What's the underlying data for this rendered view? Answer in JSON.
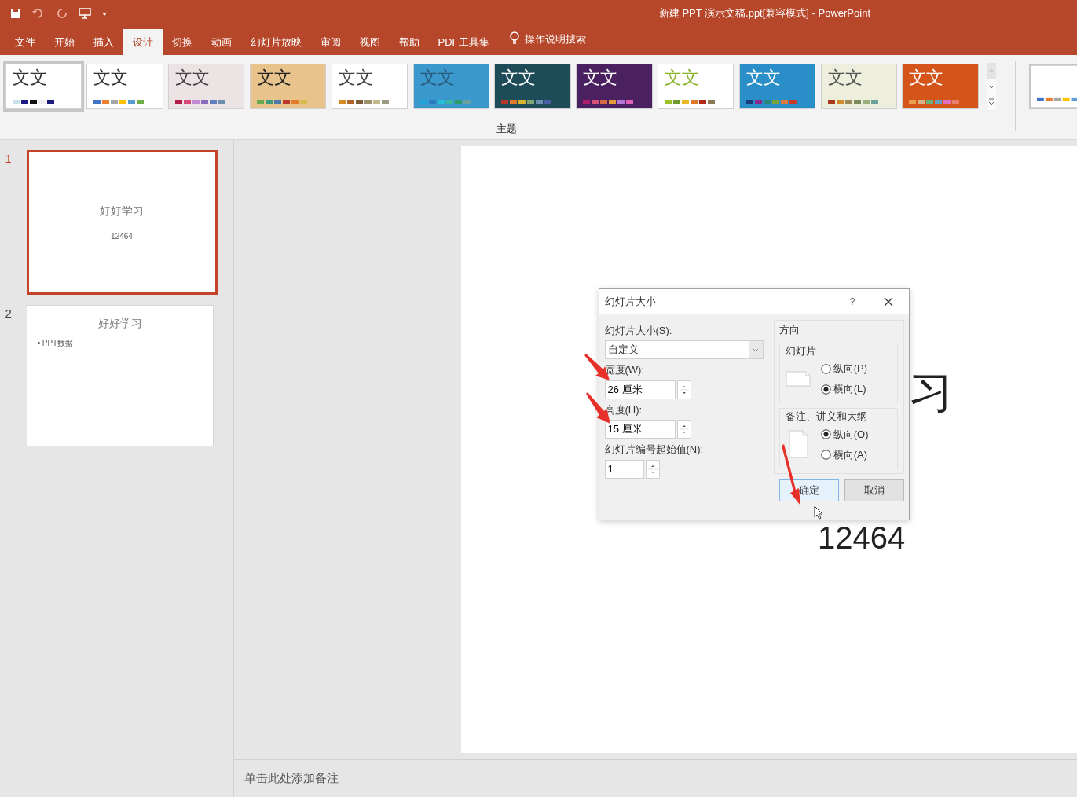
{
  "window": {
    "title": "新建 PPT 演示文稿.ppt[兼容模式]  -  PowerPoint"
  },
  "tabs": [
    {
      "label": "文件",
      "selected": false
    },
    {
      "label": "开始",
      "selected": false
    },
    {
      "label": "插入",
      "selected": false
    },
    {
      "label": "设计",
      "selected": true
    },
    {
      "label": "切换",
      "selected": false
    },
    {
      "label": "动画",
      "selected": false
    },
    {
      "label": "幻灯片放映",
      "selected": false
    },
    {
      "label": "审阅",
      "selected": false
    },
    {
      "label": "视图",
      "selected": false
    },
    {
      "label": "帮助",
      "selected": false
    },
    {
      "label": "PDF工具集",
      "selected": false
    }
  ],
  "tell_me": {
    "placeholder": "操作说明搜索"
  },
  "themes": [
    {
      "sample": {
        "text": "文文",
        "color": "#333333"
      },
      "selected": true,
      "color": "#ffffff",
      "swatches": [
        {
          "color": "#c9e2ea"
        },
        {
          "color": "#1a1a80"
        },
        {
          "color": "#111111"
        },
        {
          "color": "#eeeeee"
        },
        {
          "color": "#1a1a80"
        }
      ]
    },
    {
      "sample": {
        "text": "文文",
        "color": "#333333"
      },
      "selected": false,
      "color": "#ffffff",
      "swatches": [
        {
          "color": "#4472c4"
        },
        {
          "color": "#ed7d31"
        },
        {
          "color": "#a5a5a5"
        },
        {
          "color": "#ffc000"
        },
        {
          "color": "#5b9bd5"
        },
        {
          "color": "#70ad47"
        }
      ]
    },
    {
      "sample": {
        "text": "文文",
        "color": "#444444"
      },
      "selected": false,
      "color": "#ece4e4",
      "swatches": [
        {
          "color": "#b31b4b"
        },
        {
          "color": "#d6477a"
        },
        {
          "color": "#c28ad1"
        },
        {
          "color": "#8a6bbe"
        },
        {
          "color": "#5f7dbf"
        },
        {
          "color": "#6c8fae"
        }
      ]
    },
    {
      "sample": {
        "text": "文文",
        "color": "#222222"
      },
      "selected": false,
      "color": "#e8c48c",
      "swatches": [
        {
          "color": "#6aa84f"
        },
        {
          "color": "#3e9c7e"
        },
        {
          "color": "#4a7aa8"
        },
        {
          "color": "#b8392c"
        },
        {
          "color": "#e07b29"
        },
        {
          "color": "#d8b94b"
        }
      ]
    },
    {
      "sample": {
        "text": "文文",
        "color": "#444444"
      },
      "selected": false,
      "color": "#ffffff",
      "swatches": [
        {
          "color": "#d58b22"
        },
        {
          "color": "#b2622c"
        },
        {
          "color": "#7a5b3a"
        },
        {
          "color": "#9e8f6d"
        },
        {
          "color": "#c4b88f"
        },
        {
          "color": "#9d9a82"
        }
      ]
    },
    {
      "sample": {
        "text": "文文",
        "color": "#2a5a7a"
      },
      "selected": false,
      "color": "#3a98cc",
      "swatches": [
        {
          "color": "#1fa2d8"
        },
        {
          "color": "#2a7cc0"
        },
        {
          "color": "#25c0d8"
        },
        {
          "color": "#3bb5a0"
        },
        {
          "color": "#2e9a6a"
        },
        {
          "color": "#6aa0a0"
        }
      ]
    },
    {
      "sample": {
        "text": "文文",
        "color": "#ffffff"
      },
      "selected": false,
      "color": "#1d4c58",
      "swatches": [
        {
          "color": "#b5382a"
        },
        {
          "color": "#e07a29"
        },
        {
          "color": "#d8b32b"
        },
        {
          "color": "#7fa26e"
        },
        {
          "color": "#6a8cb0"
        },
        {
          "color": "#4a5fa0"
        }
      ]
    },
    {
      "sample": {
        "text": "文文",
        "color": "#ffffff"
      },
      "selected": false,
      "color": "#4a2060",
      "swatches": [
        {
          "color": "#b01f6e"
        },
        {
          "color": "#d74f7a"
        },
        {
          "color": "#d66a48"
        },
        {
          "color": "#e09a3a"
        },
        {
          "color": "#b676d8"
        },
        {
          "color": "#e060b8"
        }
      ]
    },
    {
      "sample": {
        "text": "文文",
        "color": "#8ab32a"
      },
      "selected": false,
      "color": "#ffffff",
      "swatches": [
        {
          "color": "#9cc22a"
        },
        {
          "color": "#6d9a2a"
        },
        {
          "color": "#e8b825"
        },
        {
          "color": "#e0782a"
        },
        {
          "color": "#b22a1a"
        },
        {
          "color": "#8a7a5a"
        }
      ]
    },
    {
      "sample": {
        "text": "文文",
        "color": "#ffffff"
      },
      "selected": false,
      "color": "#2a8fc8",
      "swatches": [
        {
          "color": "#1c3d7a"
        },
        {
          "color": "#8a2a8a"
        },
        {
          "color": "#2a8a7a"
        },
        {
          "color": "#7aa03a"
        },
        {
          "color": "#e07a3a"
        },
        {
          "color": "#c83a2a"
        }
      ]
    },
    {
      "sample": {
        "text": "文文",
        "color": "#555555"
      },
      "selected": false,
      "color": "#eeeedc",
      "swatches": [
        {
          "color": "#a83a1a"
        },
        {
          "color": "#d08a2a"
        },
        {
          "color": "#9a8a5a"
        },
        {
          "color": "#7a8a5a"
        },
        {
          "color": "#9ab07a"
        },
        {
          "color": "#6aa09a"
        }
      ]
    },
    {
      "sample": {
        "text": "文文",
        "color": "#ffffff"
      },
      "selected": false,
      "color": "#d4541a",
      "swatches": [
        {
          "color": "#e8a050"
        },
        {
          "color": "#d8b08a"
        },
        {
          "color": "#6ab07a"
        },
        {
          "color": "#6aa0c0"
        },
        {
          "color": "#e070c0"
        },
        {
          "color": "#e8806a"
        }
      ]
    }
  ],
  "ribbon_group": "主题",
  "slides": [
    {
      "number": "1",
      "selected": true,
      "title": "好好学习",
      "subtitle": "12464"
    },
    {
      "number": "2",
      "selected": false,
      "title": "好好学习",
      "bullet": "PPT数据"
    }
  ],
  "canvas": {
    "title": "习",
    "subtitle": "12464"
  },
  "dialog": {
    "title": "幻灯片大小",
    "help": "?",
    "size_label": "幻灯片大小(S):",
    "size_value": "自定义",
    "width_label": "宽度(W):",
    "width_value": "26 厘米",
    "height_label": "高度(H):",
    "height_value": "15 厘米",
    "number_label": "幻灯片编号起始值(N):",
    "number_value": "1",
    "orientation_label": "方向",
    "groups": [
      {
        "label": "幻灯片",
        "options": [
          {
            "label": "纵向(P)",
            "selected": false
          },
          {
            "label": "横向(L)",
            "selected": true
          }
        ]
      },
      {
        "label": "备注、讲义和大纲",
        "options": [
          {
            "label": "纵向(O)",
            "selected": true
          },
          {
            "label": "横向(A)",
            "selected": false
          }
        ]
      }
    ],
    "buttons": [
      {
        "label": "确定",
        "kind": "primary"
      },
      {
        "label": "取消",
        "kind": "secondary"
      }
    ]
  },
  "notes": {
    "prompt": "单击此处添加备注"
  }
}
